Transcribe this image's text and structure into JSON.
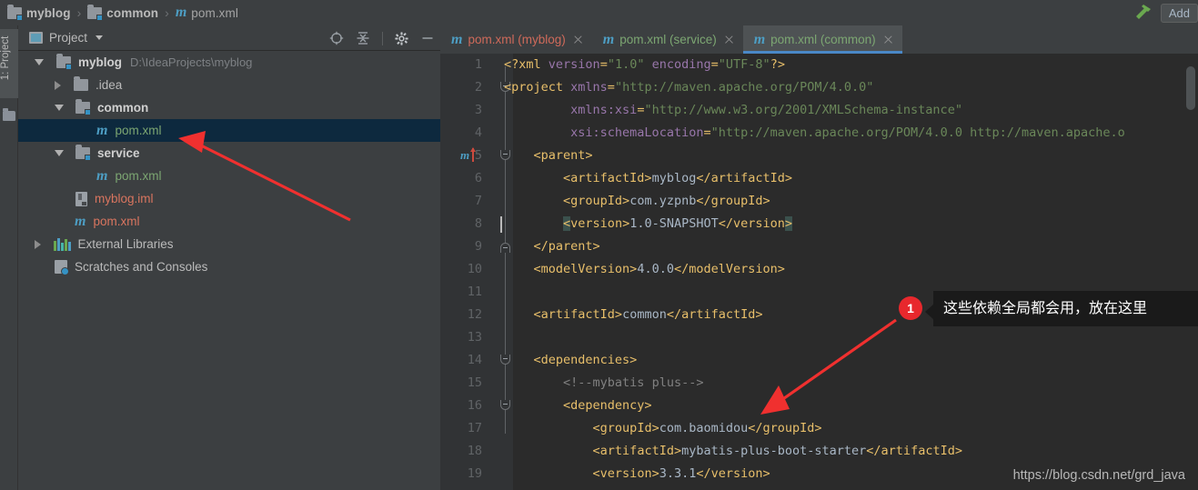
{
  "breadcrumb": {
    "items": [
      {
        "label": "myblog",
        "icon": "module-folder-icon",
        "bold": true
      },
      {
        "label": "common",
        "icon": "module-folder-icon",
        "bold": true
      },
      {
        "label": "pom.xml",
        "icon": "maven-icon",
        "bold": false
      }
    ],
    "separator": "›"
  },
  "toolbar": {
    "build_icon": "hammer-icon",
    "add_button_label": "Add"
  },
  "tool_window_tab": {
    "label": "1: Project",
    "folder_icon": "folder-icon"
  },
  "project_panel": {
    "title": "Project",
    "title_icon": "project-icon",
    "dropdown_icon": "chevron-down-icon",
    "actions": [
      {
        "name": "locate-icon",
        "title": "Select Opened File"
      },
      {
        "name": "collapse-all-icon",
        "title": "Collapse All"
      },
      {
        "name": "gear-icon",
        "title": "Settings"
      },
      {
        "name": "minimize-icon",
        "title": "Hide"
      }
    ]
  },
  "tree": {
    "rows": [
      {
        "indent": 0,
        "twisty": "down",
        "icon": "module-folder-icon",
        "label": "myblog",
        "style": "bold",
        "path": "D:\\IdeaProjects\\myblog",
        "selected": false
      },
      {
        "indent": 1,
        "twisty": "right",
        "icon": "folder-icon",
        "label": ".idea",
        "style": "plain",
        "path": "",
        "selected": false
      },
      {
        "indent": 1,
        "twisty": "down",
        "icon": "module-folder-icon",
        "label": "common",
        "style": "bold",
        "path": "",
        "selected": false
      },
      {
        "indent": 2,
        "twisty": "none",
        "icon": "maven-icon",
        "label": "pom.xml",
        "style": "green",
        "path": "",
        "selected": true
      },
      {
        "indent": 1,
        "twisty": "down",
        "icon": "module-folder-icon",
        "label": "service",
        "style": "bold",
        "path": "",
        "selected": false
      },
      {
        "indent": 2,
        "twisty": "none",
        "icon": "maven-icon",
        "label": "pom.xml",
        "style": "green",
        "path": "",
        "selected": false
      },
      {
        "indent": 1,
        "twisty": "none",
        "icon": "iml-icon",
        "label": "myblog.iml",
        "style": "orange",
        "path": "",
        "selected": false
      },
      {
        "indent": 1,
        "twisty": "none",
        "icon": "maven-icon",
        "label": "pom.xml",
        "style": "orange",
        "path": "",
        "selected": false
      },
      {
        "indent": 0,
        "twisty": "right",
        "icon": "libraries-icon",
        "label": "External Libraries",
        "style": "plain",
        "path": "",
        "selected": false
      },
      {
        "indent": 0,
        "twisty": "none",
        "icon": "scratches-icon",
        "label": "Scratches and Consoles",
        "style": "plain",
        "path": "",
        "selected": false
      }
    ]
  },
  "editor_tabs": [
    {
      "label": "pom.xml (myblog)",
      "icon": "maven-icon",
      "active": false,
      "modified": true,
      "close_icon": "close-icon"
    },
    {
      "label": "pom.xml (service)",
      "icon": "maven-icon",
      "active": false,
      "modified": false,
      "close_icon": "close-icon"
    },
    {
      "label": "pom.xml (common)",
      "icon": "maven-icon",
      "active": true,
      "modified": false,
      "close_icon": "close-icon"
    }
  ],
  "code": {
    "language": "xml",
    "file": "pom.xml (common)",
    "lines": [
      {
        "n": "1",
        "text": "<?xml version=\"1.0\" encoding=\"UTF-8\"?>"
      },
      {
        "n": "2",
        "text": "<project xmlns=\"http://maven.apache.org/POM/4.0.0\""
      },
      {
        "n": "3",
        "text": "         xmlns:xsi=\"http://www.w3.org/2001/XMLSchema-instance\""
      },
      {
        "n": "4",
        "text": "         xsi:schemaLocation=\"http://maven.apache.org/POM/4.0.0 http://maven.apache.o"
      },
      {
        "n": "5",
        "text": "    <parent>"
      },
      {
        "n": "6",
        "text": "        <artifactId>myblog</artifactId>"
      },
      {
        "n": "7",
        "text": "        <groupId>com.yzpnb</groupId>"
      },
      {
        "n": "8",
        "text": "        <version>1.0-SNAPSHOT</version>"
      },
      {
        "n": "9",
        "text": "    </parent>"
      },
      {
        "n": "10",
        "text": "    <modelVersion>4.0.0</modelVersion>"
      },
      {
        "n": "11",
        "text": ""
      },
      {
        "n": "12",
        "text": "    <artifactId>common</artifactId>"
      },
      {
        "n": "13",
        "text": ""
      },
      {
        "n": "14",
        "text": "    <dependencies>"
      },
      {
        "n": "15",
        "text": "        <!--mybatis plus-->"
      },
      {
        "n": "16",
        "text": "        <dependency>"
      },
      {
        "n": "17",
        "text": "            <groupId>com.baomidou</groupId>"
      },
      {
        "n": "18",
        "text": "            <artifactId>mybatis-plus-boot-starter</artifactId>"
      },
      {
        "n": "19",
        "text": "            <version>3.3.1</version>"
      }
    ]
  },
  "annotation": {
    "badge_number": "1",
    "text": "这些依赖全局都会用，放在这里",
    "badge_color": "#e8282d",
    "arrow_color": "#f0302f"
  },
  "watermark": "https://blog.csdn.net/grd_java"
}
